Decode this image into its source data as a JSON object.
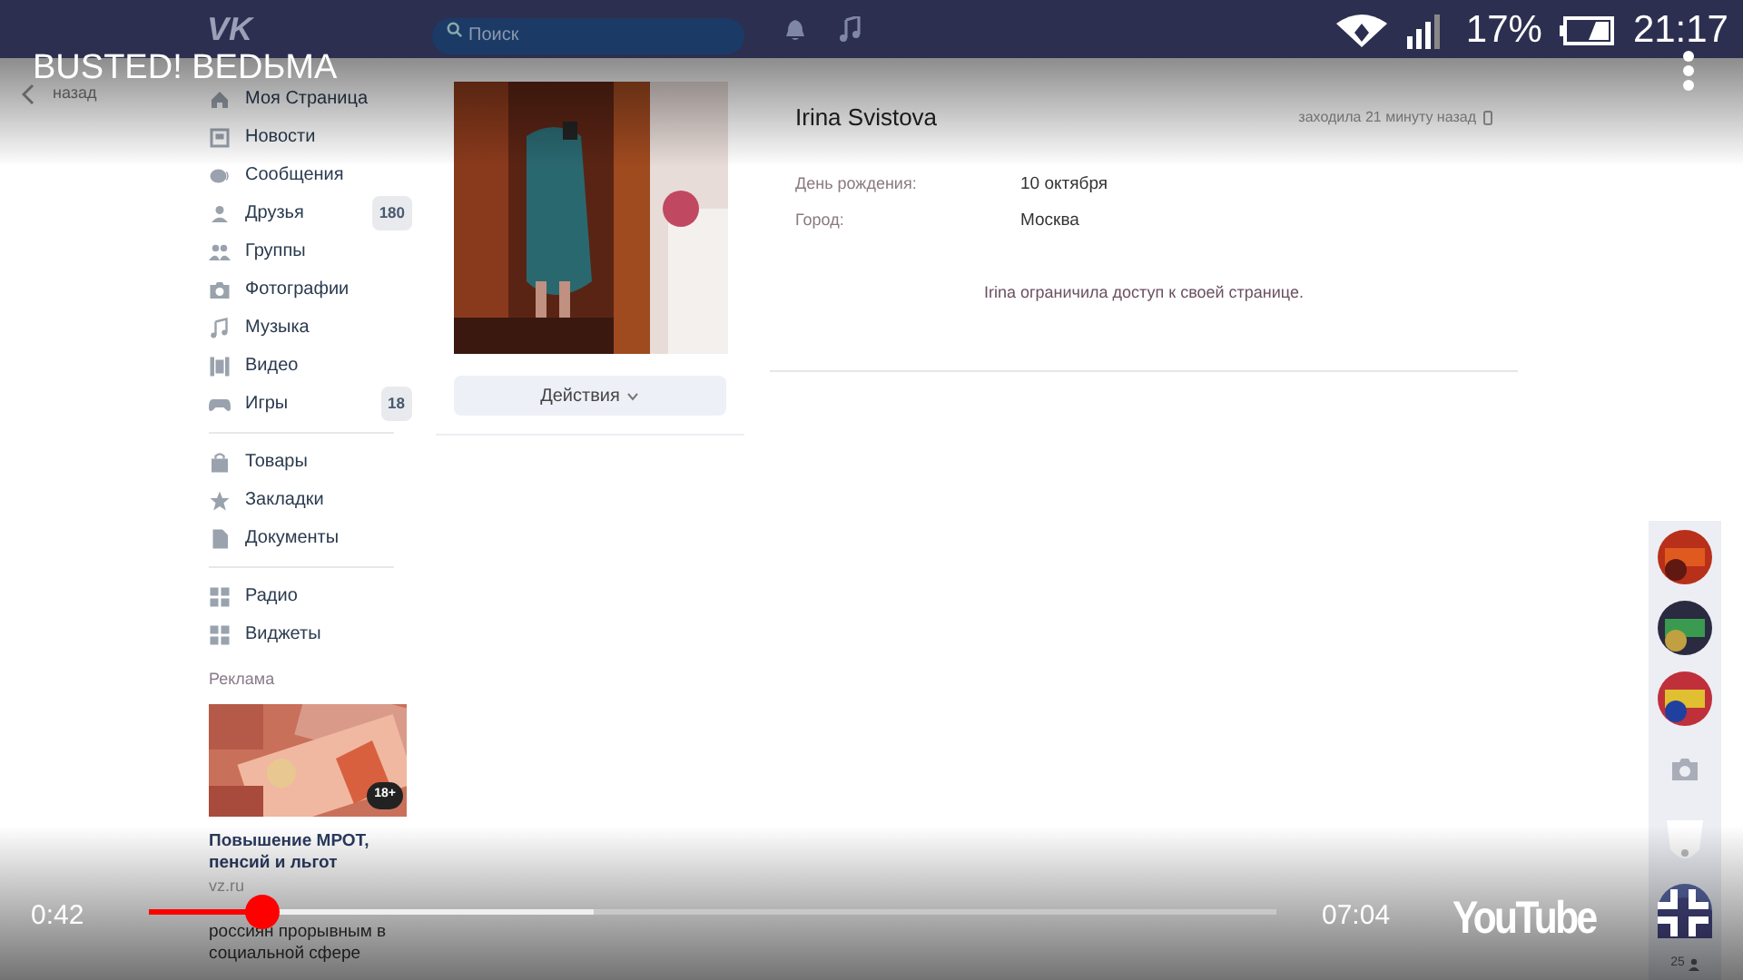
{
  "status_bar": {
    "battery": "17%",
    "time": "21:17"
  },
  "vk_header": {
    "logo": "VK",
    "search": {
      "placeholder": "Поиск"
    }
  },
  "video": {
    "title": "BUSTED! BEDЬMA",
    "elapsed": "0:42",
    "duration": "07:04",
    "brand": "YouTube",
    "progress": {
      "level": 0.1
    },
    "buffer": {
      "level": 0.395
    }
  },
  "back": "назад",
  "sidebar": {
    "groups": [
      [
        {
          "label": "Моя Страница",
          "kind": "home"
        },
        {
          "label": "Новости",
          "kind": "news"
        },
        {
          "label": "Сообщения",
          "kind": "chat"
        },
        {
          "label": "Друзья",
          "kind": "person",
          "count": "180"
        },
        {
          "label": "Группы",
          "kind": "people"
        },
        {
          "label": "Фотографии",
          "kind": "camera"
        },
        {
          "label": "Музыка",
          "kind": "note"
        },
        {
          "label": "Видео",
          "kind": "film"
        },
        {
          "label": "Игры",
          "kind": "gamepad",
          "count": "18"
        }
      ],
      [
        {
          "label": "Товары",
          "kind": "bag"
        },
        {
          "label": "Закладки",
          "kind": "star"
        },
        {
          "label": "Документы",
          "kind": "doc"
        }
      ],
      [
        {
          "label": "Радио",
          "kind": "grid"
        },
        {
          "label": "Виджеты",
          "kind": "grid"
        }
      ]
    ]
  },
  "ad": {
    "heading": "Реклама",
    "age": "18+",
    "title": "Повышение МРОТ, пенсий и льгот",
    "domain": "vz.ru",
    "text": "россиян прорывным в социальной сфере"
  },
  "profile": {
    "actions": "Действия",
    "name": "Irina Svistova",
    "last_seen": "заходила 21 минуту назад",
    "info": [
      {
        "label": "День рождения:",
        "value": "10 октября"
      },
      {
        "label": "Город:",
        "value": "Москва"
      }
    ],
    "notice": "Irina ограничила доступ к своей странице."
  },
  "friends": {
    "count": "25"
  }
}
